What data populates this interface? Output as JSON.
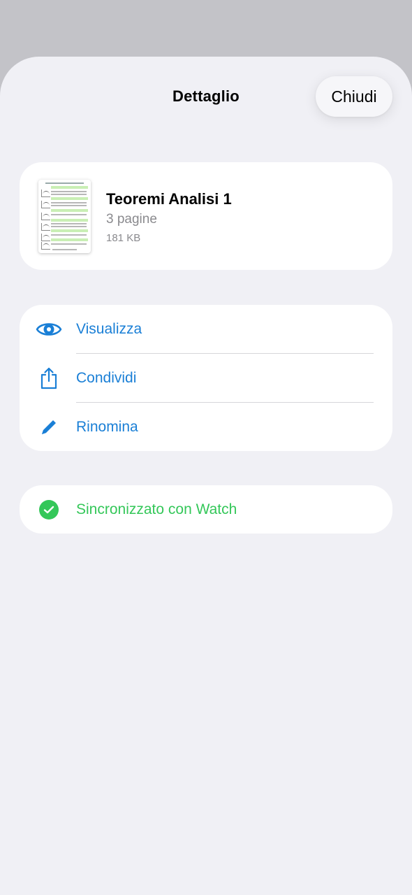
{
  "header": {
    "title": "Dettaglio",
    "close_label": "Chiudi"
  },
  "file": {
    "name": "Teoremi Analisi 1",
    "pages": "3 pagine",
    "size": "181 KB"
  },
  "actions": [
    {
      "label": "Visualizza",
      "icon": "eye-icon"
    },
    {
      "label": "Condividi",
      "icon": "share-icon"
    },
    {
      "label": "Rinomina",
      "icon": "pencil-icon"
    }
  ],
  "sync": {
    "label": "Sincronizzato con Watch",
    "icon": "checkmark-circle-icon"
  },
  "colors": {
    "accent": "#1a7fd6",
    "success": "#34c759",
    "sheet_background": "#f0f0f5",
    "dimmed_background": "#c3c3c8"
  }
}
